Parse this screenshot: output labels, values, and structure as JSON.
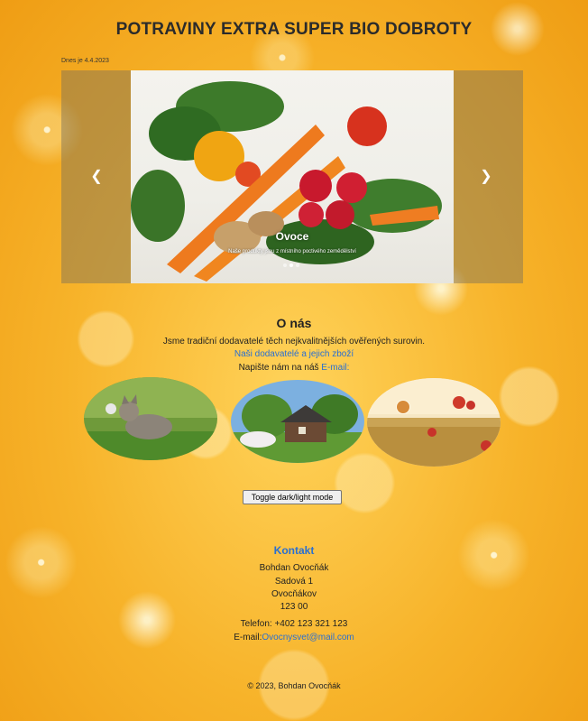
{
  "header": {
    "title": "POTRAVINY EXTRA SUPER BIO DOBROTY",
    "date": "Dnes je 4.4.2023"
  },
  "carousel": {
    "caption_title": "Ovoce",
    "caption_text": "Naše produkty jsou z místního poctivého zemědělství",
    "prev_icon": "chevron-left-icon",
    "next_icon": "chevron-right-icon",
    "slide_count": 3,
    "active_slide": 2
  },
  "about": {
    "title": "O nás",
    "text": "Jsme tradiční dodavatelé těch nejkvalitnějších ověřených surovin.",
    "suppliers_link": "Naši dodavatelé a jejich zboží",
    "write_prefix": "Napište nám na náš ",
    "email_link": "E-mail:"
  },
  "toggle_button": "Toggle dark/light mode",
  "contact": {
    "title": "Kontakt",
    "name": "Bohdan Ovocňák",
    "street": "Sadová 1",
    "city": "Ovocňákov",
    "zip": "123 00",
    "phone": "Telefon: +402 123 321 123",
    "email_label": "E-mail:",
    "email": "Ovocnysvet@mail.com"
  },
  "footer": "© 2023, Bohdan Ovocňák",
  "colors": {
    "link": "#2a6fd1",
    "background": "#f7b32a"
  }
}
